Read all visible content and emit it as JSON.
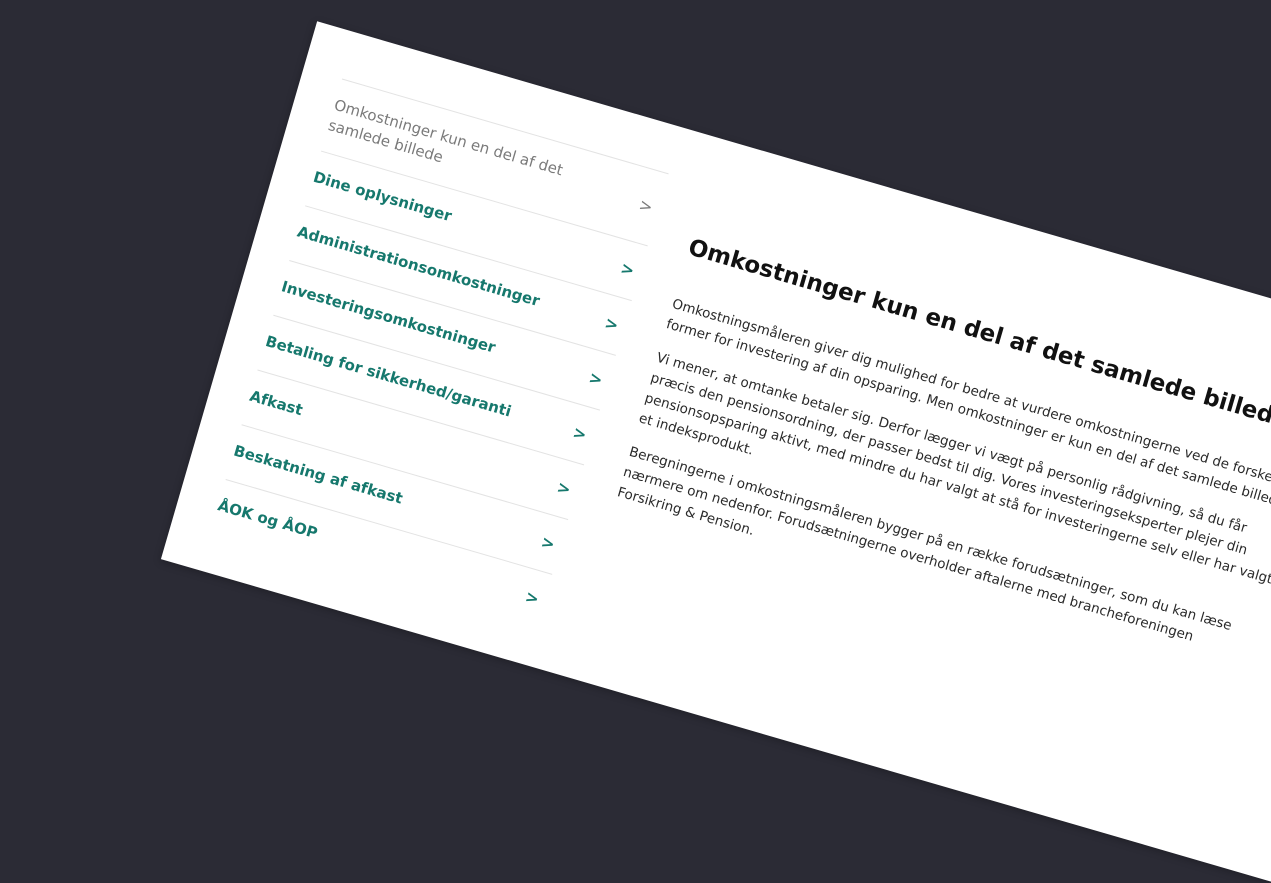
{
  "sidebar": {
    "items": [
      {
        "label": "Omkostninger kun en del af det samlede billede",
        "active": true
      },
      {
        "label": "Dine oplysninger",
        "active": false
      },
      {
        "label": "Administrationsomkostninger",
        "active": false
      },
      {
        "label": "Investeringsomkostninger",
        "active": false
      },
      {
        "label": "Betaling for sikkerhed/garanti",
        "active": false
      },
      {
        "label": "Afkast",
        "active": false
      },
      {
        "label": "Beskatning af afkast",
        "active": false
      },
      {
        "label": "ÅOK og ÅOP",
        "active": false
      }
    ],
    "chevron": ">"
  },
  "main": {
    "title": "Omkostninger kun en del af det samlede billede",
    "paragraphs": [
      "Omkostningsmåleren giver dig mulighed for bedre at vurdere omkostningerne ved de forskellige former for investering af din opsparing. Men omkostninger er kun en del af det samlede billede.",
      "Vi mener, at omtanke betaler sig. Derfor lægger vi vægt på personlig rådgivning, så du får præcis den pensionsordning, der passer bedst til dig. Vores investeringseksperter plejer din pensionsopsparing aktivt, med mindre du har valgt at stå for investeringerne selv eller har valgt et indeksprodukt.",
      "Beregningerne i omkostningsmåleren bygger på en række forudsætninger, som du kan læse nærmere om nedenfor. Forudsætningerne overholder aftalerne med brancheforeningen Forsikring & Pension."
    ]
  },
  "colors": {
    "background": "#2b2b35",
    "panel": "#ffffff",
    "link": "#16786d",
    "muted": "#7a7a7a"
  },
  "icons": {
    "chevron": "chevron-right-icon"
  }
}
